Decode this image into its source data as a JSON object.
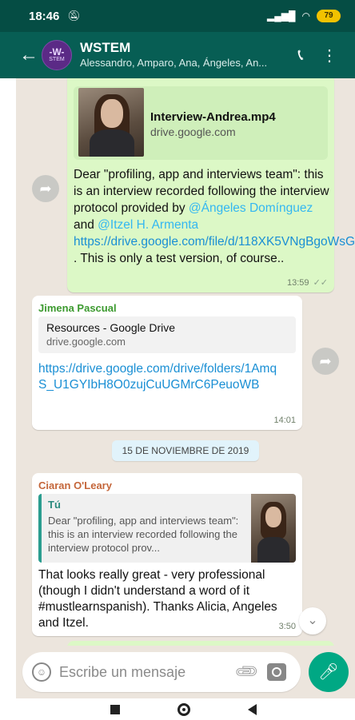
{
  "status_bar": {
    "time": "18:46",
    "mute_icon": "mute-icon",
    "signal": "4G",
    "battery": "79"
  },
  "header": {
    "group_name": "WSTEM",
    "avatar_text": "-W-",
    "avatar_sub": "STEM",
    "members": "Alessandro, Amparo, Ana, Ángeles, An..."
  },
  "messages": [
    {
      "type": "outgoing",
      "preview_title": "Interview-Andrea.mp4",
      "preview_domain": "drive.google.com",
      "text_pre": "Dear \"profiling, app and interviews team\": this is an interview recorded following the interview protocol provided by ",
      "mention1": "@Ángeles Domínguez",
      "text_and": " and ",
      "mention2": "@Itzel H. Armenta",
      "link": " https://drive.google.com/file/d/118XK5VNgBgoWsGNT6LUBSw7Xhk5JwMEv/view",
      "text_post": " . This is only a test version, of course..",
      "time": "13:59",
      "ticks": "✓✓"
    },
    {
      "type": "incoming",
      "sender": "Jimena Pascual",
      "preview_title": "Resources - Google Drive",
      "preview_domain": "drive.google.com",
      "link": "https://drive.google.com/drive/folders/1AmqS_U1GYIbH8O0zujCuUGMrC6PeuoWB",
      "time": "14:01"
    },
    {
      "type": "incoming",
      "sender": "Ciaran O'Leary",
      "quote_name": "Tú",
      "quote_text": "Dear \"profiling, app and interviews team\": this is an interview recorded following the interview protocol prov...",
      "text": "That looks really great - very professional (though I didn't understand a word of it #mustlearnspanish). Thanks Alicia, Angeles and Itzel.",
      "time": "3:50"
    }
  ],
  "date_chip": "15 DE NOVIEMBRE DE 2019",
  "input": {
    "placeholder": "Escribe un mensaje"
  },
  "colors": {
    "header": "#075e54",
    "outgoing": "#dcf8c6",
    "incoming": "#ffffff",
    "chat_bg": "#ece5dd",
    "accent": "#00a884"
  }
}
